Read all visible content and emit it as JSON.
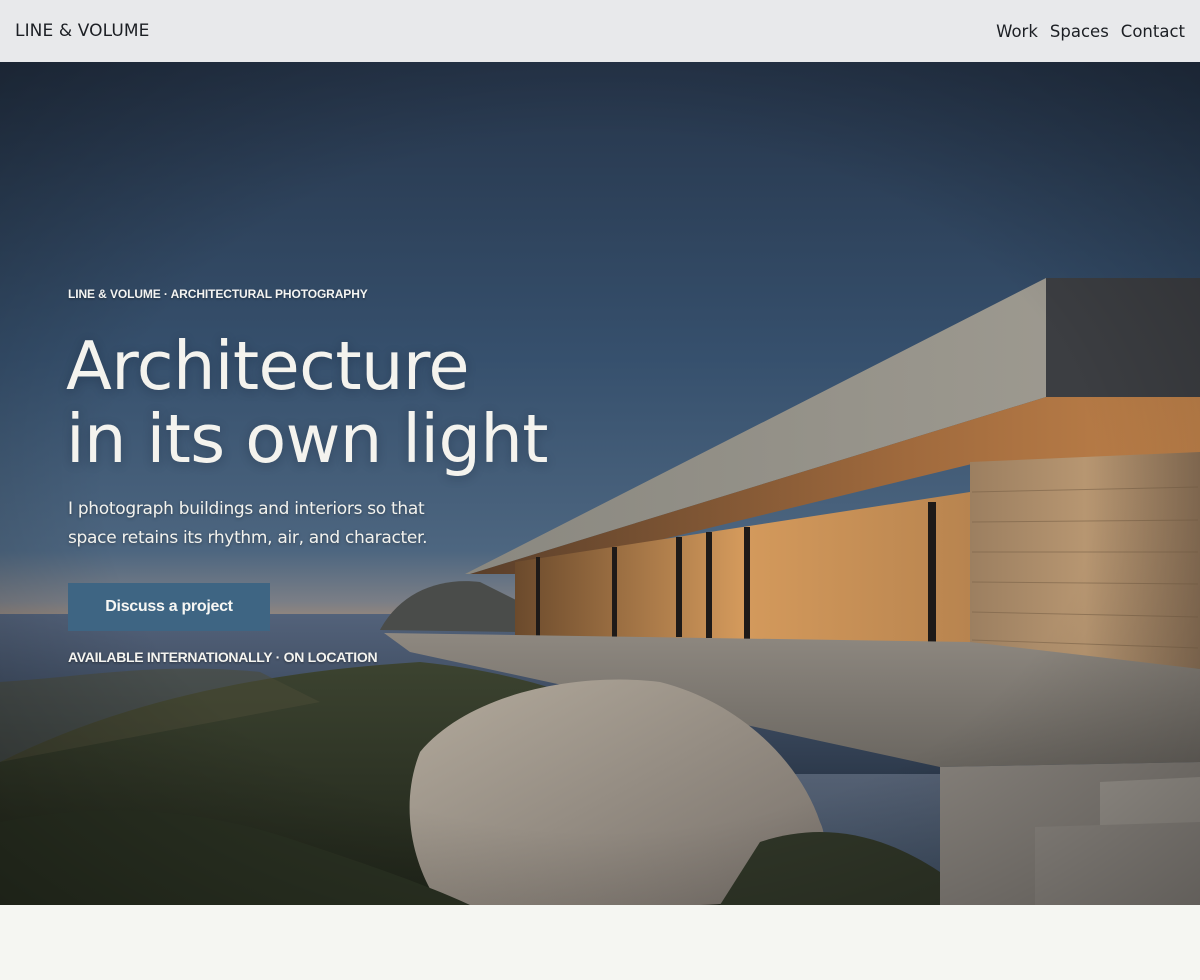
{
  "header": {
    "brand": "LINE & VOLUME",
    "nav": [
      "Work",
      "Spaces",
      "Contact"
    ]
  },
  "hero": {
    "eyebrow": "LINE & VOLUME · ARCHITECTURAL PHOTOGRAPHY",
    "headline": [
      "Architecture",
      "in its own light"
    ],
    "lede": "I photograph buildings and interiors so that space retains its rhythm, air, and character.",
    "cta": "Discuss a project",
    "availability": "AVAILABLE INTERNATIONALLY · ON LOCATION"
  },
  "colors": {
    "accent": "#3e6583",
    "header_bg": "#e8e9eb",
    "page_bg": "#f5f6f2",
    "hero_text": "#f4f3ee"
  }
}
